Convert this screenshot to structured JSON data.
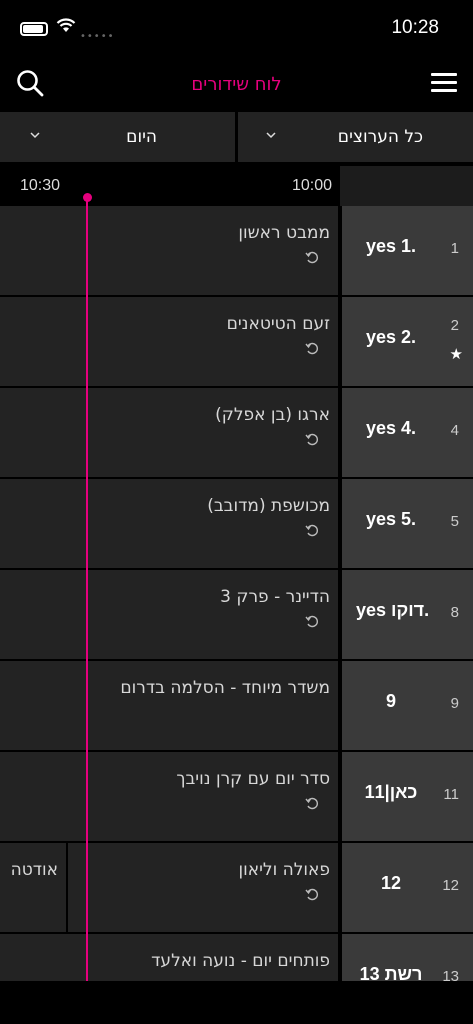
{
  "status": {
    "time": "10:28",
    "cell": "•••••"
  },
  "header": {
    "title": "לוח שידורים"
  },
  "filters": {
    "channels": "כל הערוצים",
    "day": "היום"
  },
  "timeline": {
    "t1": "10:30",
    "t2": "10:00"
  },
  "accent": "#e6007e",
  "rows": [
    {
      "num": "1",
      "logo": "yes 1.",
      "program": "ממבט ראשון",
      "rerun": true
    },
    {
      "num": "2",
      "logo": "yes 2.",
      "program": "זעם הטיטאנים",
      "rerun": true,
      "star": "★"
    },
    {
      "num": "4",
      "logo": "yes 4.",
      "program": "ארגו (בן אפלק)",
      "rerun": true
    },
    {
      "num": "5",
      "logo": "yes 5.",
      "program": "מכושפת (מדובב)",
      "rerun": true
    },
    {
      "num": "8",
      "logo": "yes דוקו.",
      "program": "הדיינר - פרק 3",
      "rerun": true
    },
    {
      "num": "9",
      "logo": "9",
      "program": "משדר מיוחד - הסלמה בדרום",
      "rerun": false
    },
    {
      "num": "11",
      "logo": "כאן|11",
      "program": "סדר יום עם קרן נויבך",
      "rerun": true
    },
    {
      "num": "12",
      "logo": "12",
      "program": "פאולה וליאון",
      "rerun": true,
      "next": "אודטה"
    },
    {
      "num": "13",
      "logo": "רשת 13",
      "program": "פותחים יום - נועה ואלעד",
      "rerun": false
    }
  ]
}
